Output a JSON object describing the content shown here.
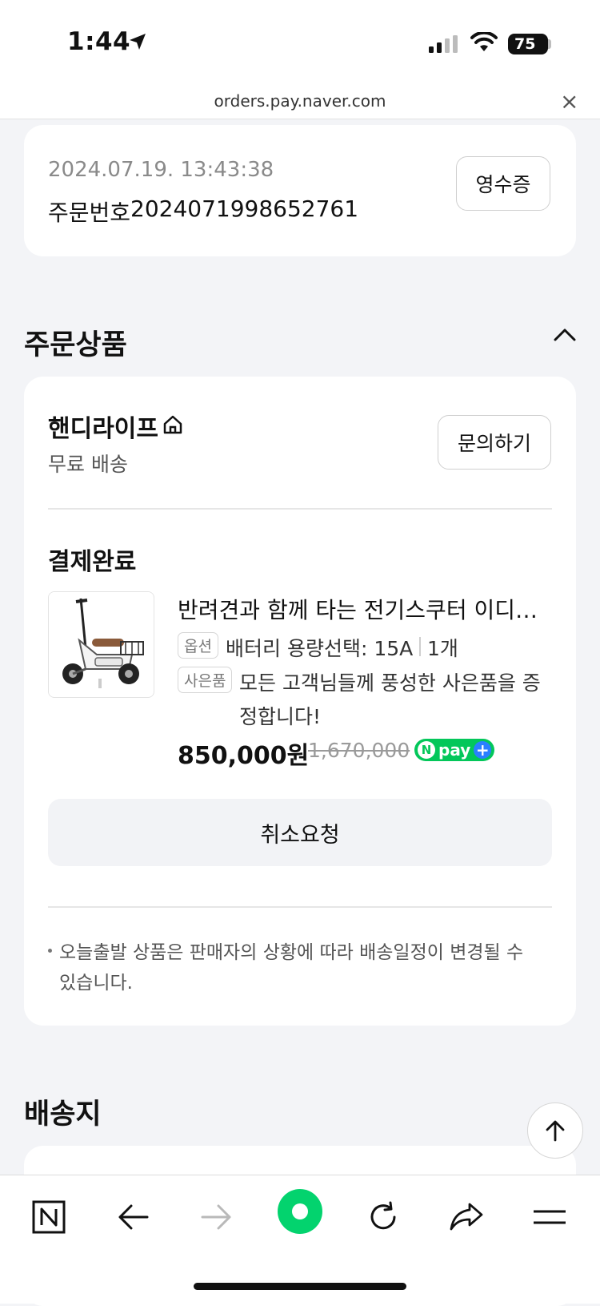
{
  "status_bar": {
    "time": "1:44",
    "battery": "75"
  },
  "browser": {
    "url": "orders.pay.naver.com",
    "close_icon": "×"
  },
  "order_info": {
    "datetime": "2024.07.19. 13:43:38",
    "order_number_label": "주문번호",
    "order_number": "2024071998652761",
    "receipt_button": "영수증"
  },
  "ordered_products": {
    "section_title": "주문상품",
    "seller_name": "핸디라이프",
    "shipping": "무료 배송",
    "inquiry_button": "문의하기",
    "status": "결제완료",
    "product": {
      "name": "반려견과 함께 타는 전기스쿠터 이디뚜바이크 미니",
      "option_tag": "옵션",
      "option_text": "배터리 용량선택: 15A",
      "quantity": "1개",
      "gift_tag": "사은품",
      "gift_text": "모든 고객님들께 풍성한 사은품을 증정합니다!",
      "price": "850,000원",
      "original_price": "1,670,000",
      "npay_label": "pay",
      "npay_n": "N",
      "npay_plus": "+"
    },
    "cancel_button": "취소요청",
    "note": "오늘출발 상품은 판매자의 상황에 따라 배송일정이 변경될 수 있습니다."
  },
  "delivery": {
    "section_title": "배송지"
  },
  "colors": {
    "naver_green": "#03c75a",
    "npay_plus_blue": "#2a7fff",
    "background": "#f3f4f7"
  },
  "icons": [
    "location-arrow-icon",
    "signal-icon",
    "wifi-icon",
    "home-icon",
    "chevron-up-icon",
    "arrow-up-icon",
    "naver-n-icon",
    "back-arrow-icon",
    "forward-arrow-icon",
    "green-dot-icon",
    "reload-icon",
    "share-icon",
    "menu-icon"
  ]
}
